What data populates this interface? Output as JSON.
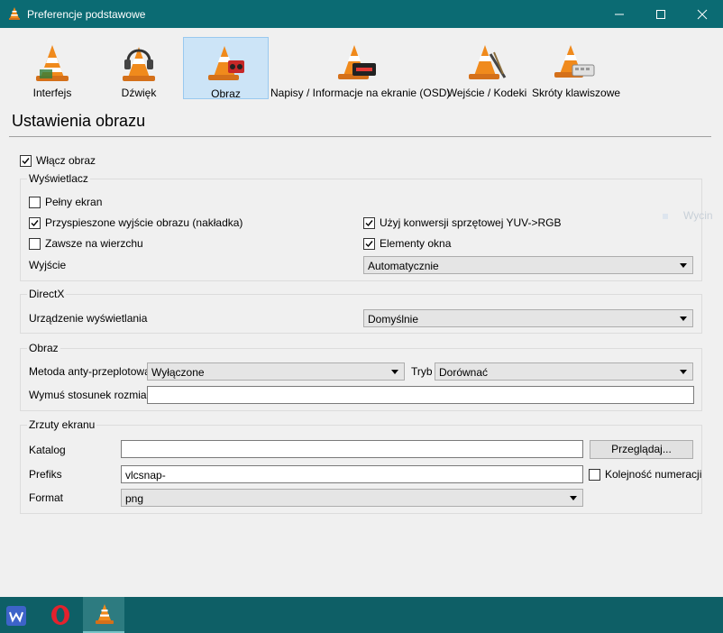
{
  "window": {
    "title": "Preferencje podstawowe",
    "icon": "vlc-cone-icon"
  },
  "categories": [
    {
      "label": "Interfejs",
      "icon": "interface-cone-icon"
    },
    {
      "label": "Dźwięk",
      "icon": "audio-headphones-cone-icon"
    },
    {
      "label": "Obraz",
      "icon": "video-cone-icon",
      "selected": true
    },
    {
      "label": "Napisy / Informacje na ekranie (OSD)",
      "icon": "subtitles-cone-icon"
    },
    {
      "label": "Wejście / Kodeki",
      "icon": "input-codecs-cone-icon"
    },
    {
      "label": "Skróty klawiszowe",
      "icon": "hotkeys-cone-icon"
    }
  ],
  "heading": "Ustawienia obrazu",
  "enable_video": {
    "label": "Włącz obraz",
    "checked": true
  },
  "display": {
    "title": "Wyświetlacz",
    "fullscreen": {
      "label": "Pełny ekran",
      "checked": false
    },
    "overlay": {
      "label": "Przyspieszone wyjście obrazu (nakładka)",
      "checked": true
    },
    "on_top": {
      "label": "Zawsze na wierzchu",
      "checked": false
    },
    "hw_yuv": {
      "label": "Użyj konwersji sprzętowej YUV->RGB",
      "checked": true
    },
    "decorations": {
      "label": "Elementy okna",
      "checked": true
    },
    "output_label": "Wyjście",
    "output_value": "Automatycznie"
  },
  "directx": {
    "title": "DirectX",
    "device_label": "Urządzenie wyświetlania",
    "device_value": "Domyślnie"
  },
  "video": {
    "title": "Obraz",
    "deinterlace_label": "Metoda anty-przeplotowa",
    "deinterlace_value": "Wyłączone",
    "mode_label": "Tryb",
    "mode_value": "Dorównać",
    "aspect_label": "Wymuś stosunek rozmiaru",
    "aspect_value": ""
  },
  "snapshots": {
    "title": "Zrzuty ekranu",
    "dir_label": "Katalog",
    "dir_value": "",
    "browse_label": "Przeglądaj...",
    "prefix_label": "Prefiks",
    "prefix_value": "vlcsnap-",
    "sequential": {
      "label": "Kolejność numeracji",
      "checked": false
    },
    "format_label": "Format",
    "format_value": "png"
  },
  "ghost_text": "Wycin",
  "taskbar": [
    {
      "icon": "wps-office-icon"
    },
    {
      "icon": "opera-browser-icon"
    },
    {
      "icon": "vlc-taskbar-icon",
      "active": true
    }
  ],
  "colors": {
    "titlebar": "#0b6b73",
    "taskbar": "#0e5f66",
    "selection": "#cce4f7",
    "cone_orange": "#f08a1c"
  }
}
